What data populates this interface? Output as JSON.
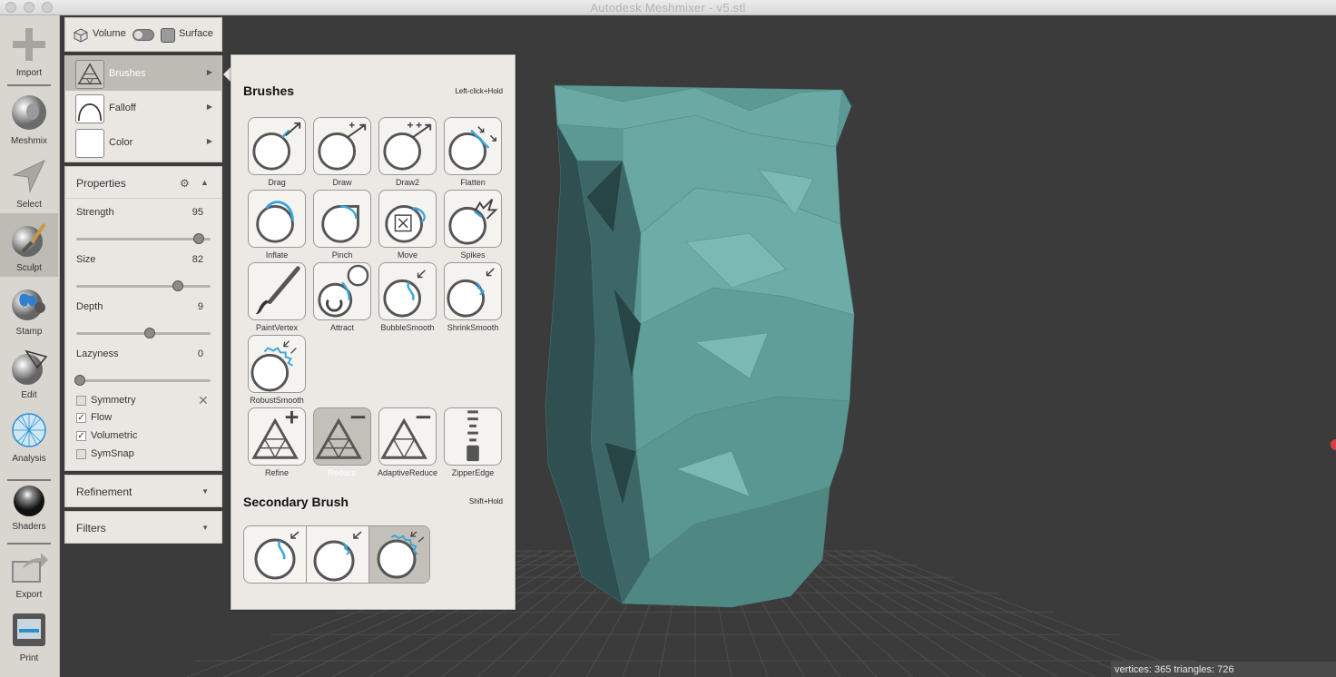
{
  "window": {
    "title": "Autodesk Meshmixer - v5.stl"
  },
  "toolbar": {
    "items": [
      {
        "label": "Import",
        "icon": "plus-icon"
      },
      {
        "label": "Meshmix",
        "icon": "meshmix-face-icon"
      },
      {
        "label": "Select",
        "icon": "select-arrow-icon"
      },
      {
        "label": "Sculpt",
        "icon": "sculpt-brush-icon",
        "active": true
      },
      {
        "label": "Stamp",
        "icon": "stamp-icon"
      },
      {
        "label": "Edit",
        "icon": "edit-sphere-icon"
      },
      {
        "label": "Analysis",
        "icon": "analysis-mesh-icon"
      },
      {
        "label": "Shaders",
        "icon": "shader-ball-icon"
      },
      {
        "label": "Export",
        "icon": "export-icon"
      },
      {
        "label": "Print",
        "icon": "print-icon"
      }
    ]
  },
  "mode": {
    "volume_label": "Volume",
    "surface_label": "Surface"
  },
  "brush_list": [
    {
      "label": "Brushes",
      "selected": true
    },
    {
      "label": "Falloff"
    },
    {
      "label": "Color"
    }
  ],
  "properties": {
    "title": "Properties",
    "sliders": [
      {
        "label": "Strength",
        "value": "95",
        "fraction": 0.91
      },
      {
        "label": "Size",
        "value": "82",
        "fraction": 0.76
      },
      {
        "label": "Depth",
        "value": "9",
        "fraction": 0.55
      },
      {
        "label": "Lazyness",
        "value": "0",
        "fraction": 0.03
      }
    ],
    "checkboxes": [
      {
        "label": "Symmetry",
        "checked": false
      },
      {
        "label": "Flow",
        "checked": true
      },
      {
        "label": "Volumetric",
        "checked": true
      },
      {
        "label": "SymSnap",
        "checked": false
      }
    ]
  },
  "refinement": {
    "title": "Refinement"
  },
  "filters": {
    "title": "Filters"
  },
  "popup": {
    "title": "Brushes",
    "hint": "Left-click+Hold",
    "brushes": [
      {
        "name": "Drag"
      },
      {
        "name": "Draw"
      },
      {
        "name": "Draw2"
      },
      {
        "name": "Flatten"
      },
      {
        "name": "Inflate"
      },
      {
        "name": "Pinch"
      },
      {
        "name": "Move"
      },
      {
        "name": "Spikes"
      },
      {
        "name": "PaintVertex"
      },
      {
        "name": "Attract"
      },
      {
        "name": "BubbleSmooth"
      },
      {
        "name": "ShrinkSmooth"
      },
      {
        "name": "RobustSmooth"
      }
    ],
    "refine_brushes": [
      {
        "name": "Refine"
      },
      {
        "name": "Reduce",
        "selected": true
      },
      {
        "name": "AdaptiveReduce"
      },
      {
        "name": "ZipperEdge"
      }
    ],
    "secondary_title": "Secondary Brush",
    "secondary_hint": "Shift+Hold"
  },
  "status": {
    "text": "vertices: 365 triangles: 726"
  },
  "colors": {
    "mesh": "#5e9c98",
    "background": "#3b3b3b",
    "panel": "#eae7e2",
    "accent": "#3aa7d9"
  }
}
